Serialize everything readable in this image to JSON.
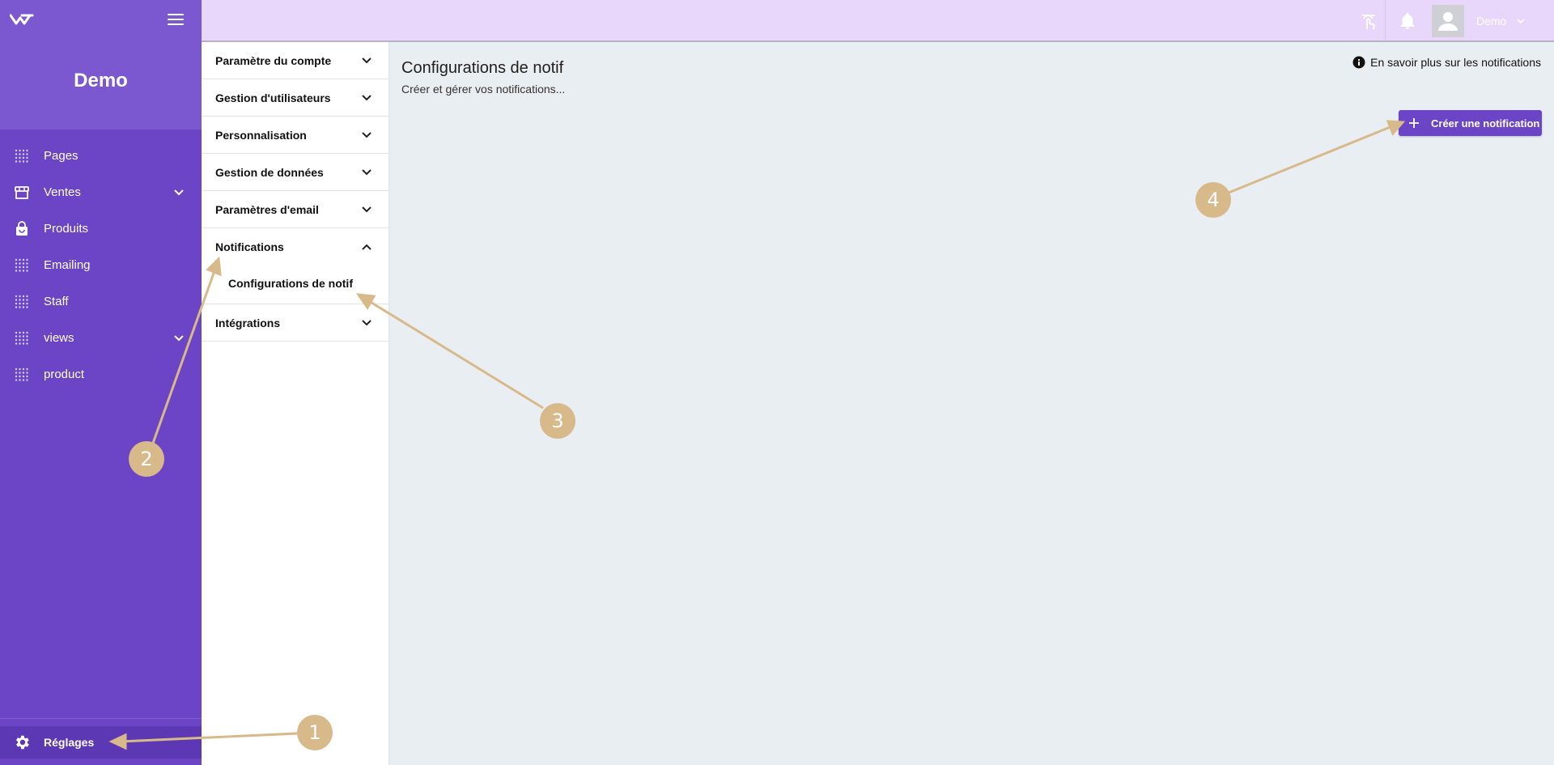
{
  "sidebar": {
    "app_name": "Demo",
    "items": [
      {
        "label": "Pages",
        "icon": "grid-icon"
      },
      {
        "label": "Ventes",
        "icon": "store-icon",
        "expandable": true
      },
      {
        "label": "Produits",
        "icon": "shopping-bag-icon"
      },
      {
        "label": "Emailing",
        "icon": "grid-icon"
      },
      {
        "label": "Staff",
        "icon": "grid-icon"
      },
      {
        "label": "views",
        "icon": "grid-icon",
        "expandable": true
      },
      {
        "label": "product",
        "icon": "grid-icon"
      }
    ],
    "settings_label": "Réglages"
  },
  "topbar": {
    "user_name": "Demo",
    "icons": [
      "touch-icon",
      "bell-icon",
      "user-avatar-icon"
    ]
  },
  "settings_panel": {
    "sections": [
      {
        "label": "Paramètre du compte"
      },
      {
        "label": "Gestion d'utilisateurs"
      },
      {
        "label": "Personnalisation"
      },
      {
        "label": "Gestion de données"
      },
      {
        "label": "Paramètres d'email"
      },
      {
        "label": "Notifications",
        "open": true,
        "children": [
          "Configurations de notif"
        ]
      },
      {
        "label": "Intégrations"
      }
    ]
  },
  "main": {
    "title": "Configurations de notif",
    "subtitle": "Créer et gérer vos notifications...",
    "learn_more": "En savoir plus sur les notifications",
    "create_button": "Créer une notification"
  },
  "annotations": {
    "markers": [
      "1",
      "2",
      "3",
      "4"
    ]
  },
  "colors": {
    "sidebar": "#6c45c6",
    "sidebar_header": "#7b57d0",
    "topbar": "#e8d6fb",
    "accent": "#6c45c6",
    "main_bg": "#e9eef2",
    "marker": "#d7b98a"
  }
}
